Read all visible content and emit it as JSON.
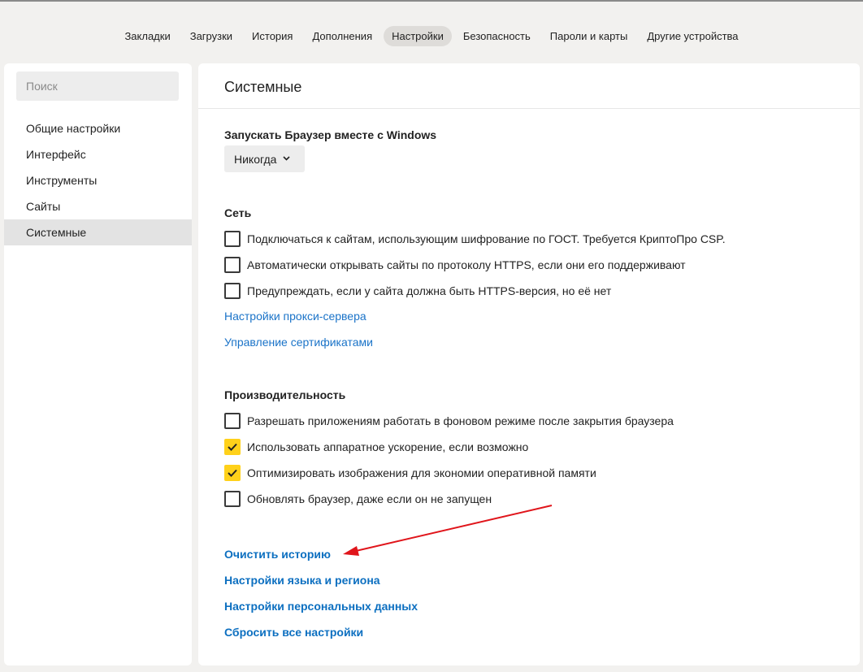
{
  "topnav": {
    "items": [
      "Закладки",
      "Загрузки",
      "История",
      "Дополнения",
      "Настройки",
      "Безопасность",
      "Пароли и карты",
      "Другие устройства"
    ],
    "active": "Настройки"
  },
  "sidebar": {
    "search_placeholder": "Поиск",
    "items": [
      "Общие настройки",
      "Интерфейс",
      "Инструменты",
      "Сайты",
      "Системные"
    ],
    "active": "Системные"
  },
  "main": {
    "title": "Системные",
    "startup": {
      "label": "Запускать Браузер вместе с Windows",
      "dropdown_value": "Никогда"
    },
    "network": {
      "heading": "Сеть",
      "options": [
        {
          "label": "Подключаться к сайтам, использующим шифрование по ГОСТ. Требуется КриптоПро CSP.",
          "checked": false
        },
        {
          "label": "Автоматически открывать сайты по протоколу HTTPS, если они его поддерживают",
          "checked": false
        },
        {
          "label": "Предупреждать, если у сайта должна быть HTTPS-версия, но её нет",
          "checked": false
        }
      ],
      "links": [
        "Настройки прокси-сервера",
        "Управление сертификатами"
      ]
    },
    "performance": {
      "heading": "Производительность",
      "options": [
        {
          "label": "Разрешать приложениям работать в фоновом режиме после закрытия браузера",
          "checked": false
        },
        {
          "label": "Использовать аппаратное ускорение, если возможно",
          "checked": true
        },
        {
          "label": "Оптимизировать изображения для экономии оперативной памяти",
          "checked": true
        },
        {
          "label": "Обновлять браузер, даже если он не запущен",
          "checked": false
        }
      ]
    },
    "bottom_links": [
      "Очистить историю",
      "Настройки языка и региона",
      "Настройки персональных данных",
      "Сбросить все настройки"
    ]
  },
  "colors": {
    "accent_checkbox": "#ffd11a",
    "link": "#1a73c8",
    "annotation_arrow": "#e0151b"
  },
  "icons": {
    "dropdown": "chevron-down-icon",
    "checked": "check-icon"
  }
}
